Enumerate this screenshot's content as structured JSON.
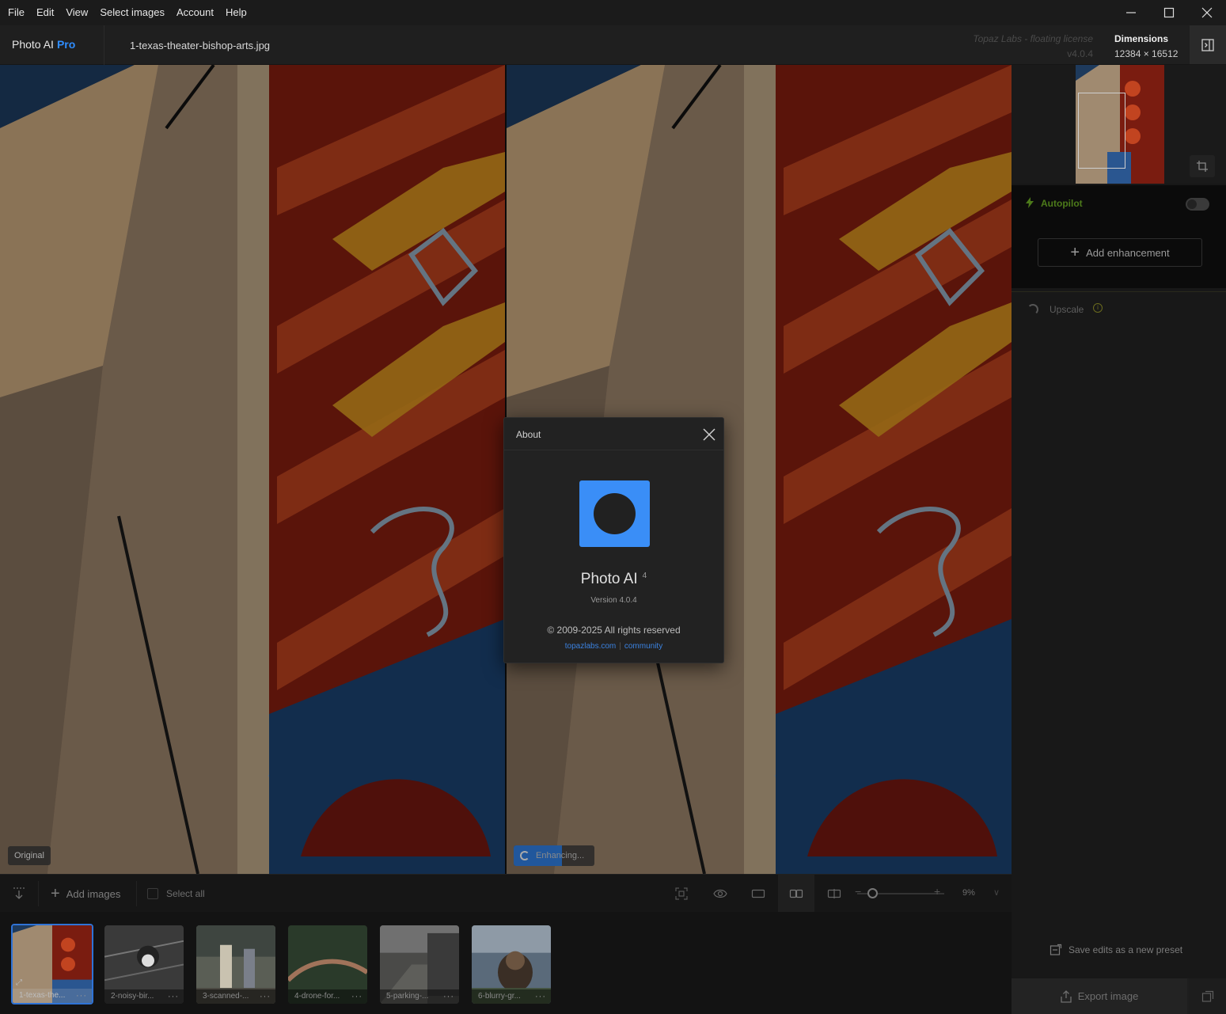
{
  "menu": {
    "items": [
      "File",
      "Edit",
      "View",
      "Select images",
      "Account",
      "Help"
    ]
  },
  "window_controls": {
    "minimize_icon": "minimize-icon",
    "maximize_icon": "maximize-icon",
    "close_icon": "close-icon"
  },
  "header": {
    "app_name": "Photo AI",
    "tier": "Pro",
    "filename": "1-texas-theater-bishop-arts.jpg",
    "license_name": "Topaz Labs - floating license",
    "license_version": "v4.0.4",
    "dimensions_label": "Dimensions",
    "dimensions_value": "12384 × 16512"
  },
  "viewer": {
    "left_label": "Original",
    "right_label": "Enhancing...",
    "enhancing_progress": 0.6
  },
  "right_panel": {
    "autopilot_label": "Autopilot",
    "autopilot_enabled": false,
    "add_enhancement_label": "Add enhancement",
    "upscale_label": "Upscale",
    "save_preset_label": "Save edits as a new preset",
    "export_label": "Export image"
  },
  "toolbar": {
    "add_images_label": "Add images",
    "select_all_label": "Select all",
    "zoom_value": "9%",
    "zoom_level": 0.1
  },
  "filmstrip": {
    "items": [
      {
        "caption": "1-texas-the...",
        "selected": true
      },
      {
        "caption": "2-noisy-bir...",
        "selected": false
      },
      {
        "caption": "3-scanned-...",
        "selected": false
      },
      {
        "caption": "4-drone-for...",
        "selected": false
      },
      {
        "caption": "5-parking-...",
        "selected": false
      },
      {
        "caption": "6-blurry-gr...",
        "selected": false
      }
    ],
    "more_label": "···"
  },
  "about_dialog": {
    "title": "About",
    "product_name": "Photo AI",
    "product_major": "4",
    "version": "Version 4.0.4",
    "copyright": "© 2009-2025 All rights reserved",
    "link_site": "topazlabs.com",
    "link_community": "community"
  },
  "colors": {
    "accent_blue": "#2f8dff",
    "logo_blue": "#3a8ef7",
    "autopilot_green": "#4c7a1a"
  }
}
